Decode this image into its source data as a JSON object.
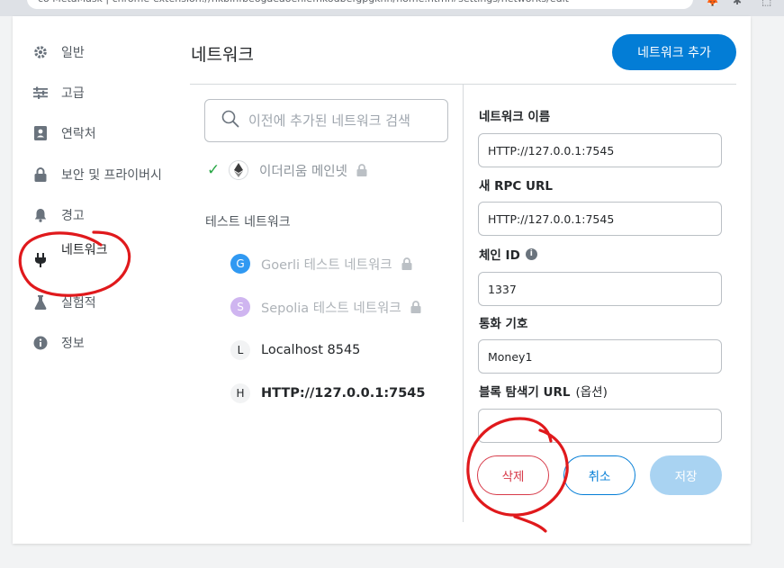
{
  "browser": {
    "address_text": "co   MetaMask  |  chrome-extension://nkbihfbeogaeaoehlefnkodbefgpgknn/home.html#settings/networks/edit",
    "ext_icons": [
      "🦊",
      "✱",
      "⬚"
    ]
  },
  "sidebar": {
    "items": [
      {
        "label": "일반",
        "icon": "gear-icon"
      },
      {
        "label": "고급",
        "icon": "sliders-icon"
      },
      {
        "label": "연락처",
        "icon": "contact-book-icon"
      },
      {
        "label": "보안 및 프라이버시",
        "icon": "lock-icon"
      },
      {
        "label": "경고",
        "icon": "bell-icon"
      },
      {
        "label": "네트워크",
        "icon": "plug-icon"
      },
      {
        "label": "실험적",
        "icon": "flask-icon"
      },
      {
        "label": "정보",
        "icon": "info-icon"
      }
    ]
  },
  "header": {
    "title": "네트워크",
    "add_network_label": "네트워크 추가"
  },
  "network_list": {
    "search_placeholder": "이전에 추가된 네트워크 검색",
    "mainnet": {
      "name": "이더리움 메인넷",
      "locked": true,
      "selected": true
    },
    "test_section_label": "테스트 네트워크",
    "networks": [
      {
        "initial": "G",
        "name": "Goerli 테스트 네트워크",
        "locked": true,
        "color": "#3099f2"
      },
      {
        "initial": "S",
        "name": "Sepolia 테스트 네트워크",
        "locked": true,
        "color": "#cfb5f0"
      },
      {
        "initial": "L",
        "name": "Localhost 8545",
        "locked": false
      },
      {
        "initial": "H",
        "name": "HTTP://127.0.0.1:7545",
        "locked": false,
        "active": true
      }
    ]
  },
  "form": {
    "network_name_label": "네트워크 이름",
    "network_name_value": "HTTP://127.0.0.1:7545",
    "rpc_url_label": "새 RPC URL",
    "rpc_url_value": "HTTP://127.0.0.1:7545",
    "chain_id_label": "체인 ID",
    "chain_id_value": "1337",
    "currency_symbol_label": "통화 기호",
    "currency_symbol_value": "Money1",
    "explorer_label": "블록 탐색기 URL",
    "explorer_optional": "(옵션)",
    "explorer_value": ""
  },
  "buttons": {
    "delete": "삭제",
    "cancel": "취소",
    "save": "저장"
  },
  "colors": {
    "accent": "#037dd6",
    "danger": "#d73a49",
    "annotation": "#e0191c"
  }
}
